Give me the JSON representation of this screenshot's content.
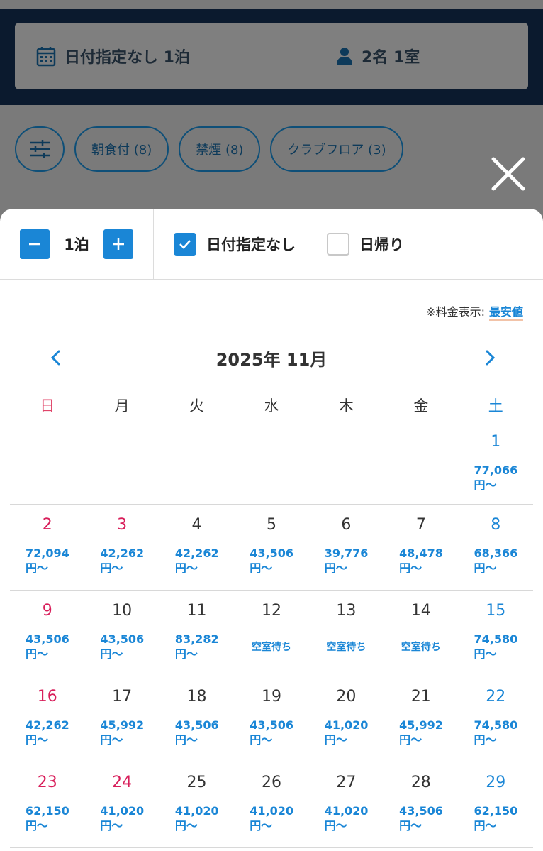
{
  "search": {
    "date_text": "日付指定なし 1泊",
    "guests_text": "2名 1室"
  },
  "chips": [
    "朝食付 (8)",
    "禁煙 (8)",
    "クラブフロア (3)"
  ],
  "controls": {
    "nights_value": "1泊",
    "no_date_label": "日付指定なし",
    "no_date_checked": true,
    "day_trip_label": "日帰り",
    "day_trip_checked": false
  },
  "price_note": {
    "label": "※料金表示:",
    "mode": "最安値"
  },
  "calendar": {
    "month_title": "2025年 11月",
    "weekdays": [
      "日",
      "月",
      "火",
      "水",
      "木",
      "金",
      "土"
    ],
    "price_suffix": "円〜",
    "weeks": [
      [
        null,
        null,
        null,
        null,
        null,
        null,
        {
          "d": "1",
          "p": "77,066"
        }
      ],
      [
        {
          "d": "2",
          "p": "72,094"
        },
        {
          "d": "3",
          "p": "42,262",
          "hol": true
        },
        {
          "d": "4",
          "p": "42,262"
        },
        {
          "d": "5",
          "p": "43,506"
        },
        {
          "d": "6",
          "p": "39,776"
        },
        {
          "d": "7",
          "p": "48,478"
        },
        {
          "d": "8",
          "p": "68,366"
        }
      ],
      [
        {
          "d": "9",
          "p": "43,506"
        },
        {
          "d": "10",
          "p": "43,506"
        },
        {
          "d": "11",
          "p": "83,282"
        },
        {
          "d": "12",
          "w": "空室待ち"
        },
        {
          "d": "13",
          "w": "空室待ち"
        },
        {
          "d": "14",
          "w": "空室待ち"
        },
        {
          "d": "15",
          "p": "74,580"
        }
      ],
      [
        {
          "d": "16",
          "p": "42,262"
        },
        {
          "d": "17",
          "p": "45,992"
        },
        {
          "d": "18",
          "p": "43,506"
        },
        {
          "d": "19",
          "p": "43,506"
        },
        {
          "d": "20",
          "p": "41,020"
        },
        {
          "d": "21",
          "p": "45,992"
        },
        {
          "d": "22",
          "p": "74,580"
        }
      ],
      [
        {
          "d": "23",
          "p": "62,150"
        },
        {
          "d": "24",
          "p": "41,020",
          "hol": true
        },
        {
          "d": "25",
          "p": "41,020"
        },
        {
          "d": "26",
          "p": "41,020"
        },
        {
          "d": "27",
          "p": "41,020"
        },
        {
          "d": "28",
          "p": "43,506"
        },
        {
          "d": "29",
          "p": "62,150"
        }
      ]
    ]
  },
  "colors": {
    "accent": "#1a86d6",
    "sunday": "#d81e5a",
    "saturday": "#1a86d6"
  }
}
